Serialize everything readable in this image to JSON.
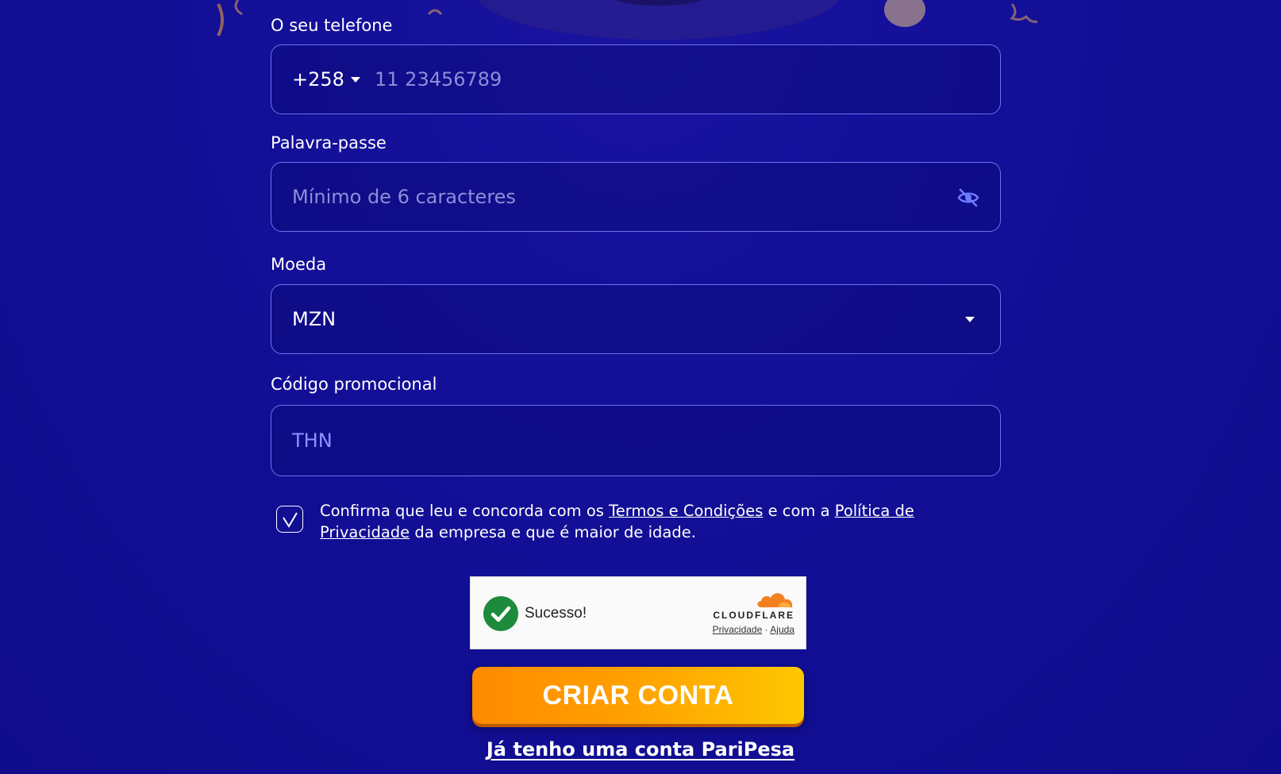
{
  "phone": {
    "label": "O seu telefone",
    "country_code": "+258",
    "placeholder": "11 23456789"
  },
  "password": {
    "label": "Palavra-passe",
    "placeholder": "Mínimo de 6 caracteres",
    "toggle_icon": "eye-slash-icon"
  },
  "currency": {
    "label": "Moeda",
    "selected": "MZN"
  },
  "promo": {
    "label": "Código promocional",
    "value": "THN"
  },
  "consent": {
    "checked": true,
    "text_before": "Confirma que leu e concorda com os ",
    "terms_link": "Termos e Condições",
    "text_middle": " e com a ",
    "privacy_link": "Política de Privacidade",
    "text_after": " da empresa e que é maior de idade."
  },
  "captcha": {
    "status": "Sucesso!",
    "brand": "CLOUDFLARE",
    "privacy_link": "Privacidade",
    "separator": "·",
    "help_link": "Ajuda"
  },
  "actions": {
    "create_account": "CRIAR CONTA",
    "login_link": "Já tenho uma conta PariPesa"
  },
  "colors": {
    "background": "#120e93",
    "field_border": "#6b72f0",
    "button_orange": "#ffa200",
    "captcha_green": "#1e8a3c",
    "cloudflare_orange": "#f48120"
  }
}
